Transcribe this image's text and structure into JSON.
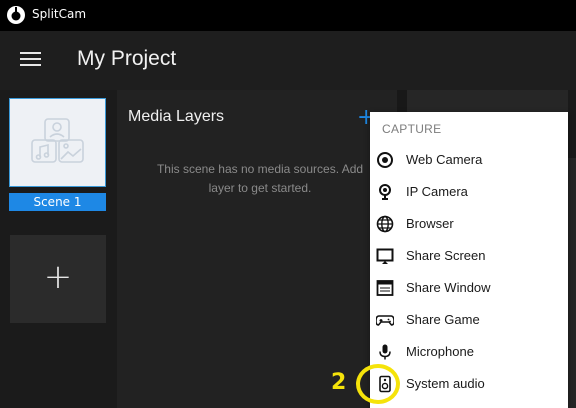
{
  "app": {
    "name": "SplitCam"
  },
  "header": {
    "title": "My Project"
  },
  "scenes": {
    "items": [
      {
        "label": "Scene 1"
      }
    ],
    "add_label": "+"
  },
  "layers": {
    "title": "Media Layers",
    "add_icon": "+",
    "empty_line1": "This scene has no media sources. Add",
    "empty_line2": "layer to get started."
  },
  "menu": {
    "header": "CAPTURE",
    "items": [
      {
        "label": "Web Camera",
        "icon": "webcam-icon"
      },
      {
        "label": "IP Camera",
        "icon": "ip-camera-icon"
      },
      {
        "label": "Browser",
        "icon": "globe-icon"
      },
      {
        "label": "Share Screen",
        "icon": "screen-icon"
      },
      {
        "label": "Share Window",
        "icon": "window-icon"
      },
      {
        "label": "Share Game",
        "icon": "gamepad-icon"
      },
      {
        "label": "Microphone",
        "icon": "microphone-icon"
      },
      {
        "label": "System audio",
        "icon": "speaker-icon"
      }
    ]
  },
  "annotation": {
    "number": "2",
    "color": "#f5e30a"
  },
  "colors": {
    "accent": "#1e88e5"
  }
}
